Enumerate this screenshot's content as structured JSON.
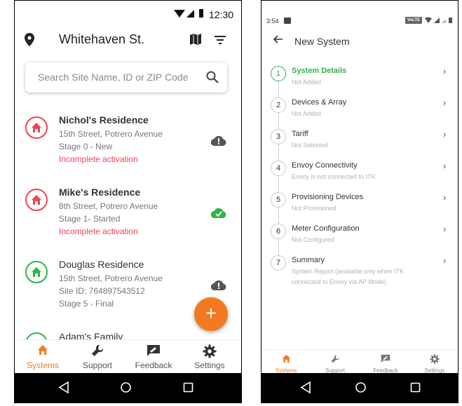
{
  "phone_a": {
    "status_bar": {
      "time": "12:30"
    },
    "header": {
      "location": "Whitehaven St."
    },
    "search": {
      "placeholder": "Search Site Name, ID or ZIP Code"
    },
    "sites": [
      {
        "name": "Nichol's Residence",
        "address": "15th Street, Potrero Avenue",
        "stage": "Stage 0 - New",
        "warning": "Incomplete activation",
        "status": "error",
        "color": "#ef4455"
      },
      {
        "name": "Mike's Residence",
        "address": "8th Street, Potrero Avenue",
        "stage": "Stage 1- Started",
        "warning": "Incomplete activation",
        "status": "ok",
        "color": "#ef4455"
      },
      {
        "name": "Douglas Residence",
        "address": "15th Street, Potrero Avenue",
        "site_id": "Site ID: 764897543512",
        "stage": "Stage 5 - Final",
        "status": "error",
        "color": "#2fb34a"
      },
      {
        "name": "Adam's Family",
        "color": "#2fb34a"
      }
    ],
    "fab": {
      "icon": "plus-icon",
      "label": "+"
    },
    "tabs": [
      {
        "label": "Systems",
        "icon": "home-icon",
        "active": true
      },
      {
        "label": "Support",
        "icon": "wrench-icon",
        "active": false
      },
      {
        "label": "Feedback",
        "icon": "feedback-icon",
        "active": false
      },
      {
        "label": "Settings",
        "icon": "gear-icon",
        "active": false
      }
    ]
  },
  "phone_b": {
    "status_bar": {
      "time": "3:54",
      "network_badge": "VoLTE"
    },
    "header": {
      "title": "New System",
      "back_icon": "arrow-left-icon"
    },
    "steps": [
      {
        "number": "1",
        "label": "System Details",
        "status": "Not Added",
        "active": true
      },
      {
        "number": "2",
        "label": "Devices & Array",
        "status": "Not Added"
      },
      {
        "number": "3",
        "label": "Tariff",
        "status": "Not Selected"
      },
      {
        "number": "4",
        "label": "Envoy Connectivity",
        "status": "Envoy is not connected to ITK"
      },
      {
        "number": "5",
        "label": "Provisioning Devices",
        "status": "Not Provisioned"
      },
      {
        "number": "6",
        "label": "Meter Configuration",
        "status": "Not Configured"
      },
      {
        "number": "7",
        "label": "Summary",
        "status": "System Report (available only when ITK connected to Envoy via AP Mode)"
      }
    ],
    "tabs": [
      {
        "label": "Systems",
        "icon": "home-icon",
        "active": true
      },
      {
        "label": "Support",
        "icon": "wrench-icon",
        "active": false
      },
      {
        "label": "Feedback",
        "icon": "feedback-icon",
        "active": false
      },
      {
        "label": "Settings",
        "icon": "gear-icon",
        "active": false
      }
    ]
  },
  "colors": {
    "accent": "#f47a22",
    "success": "#2fb34a",
    "error": "#ef4455"
  }
}
